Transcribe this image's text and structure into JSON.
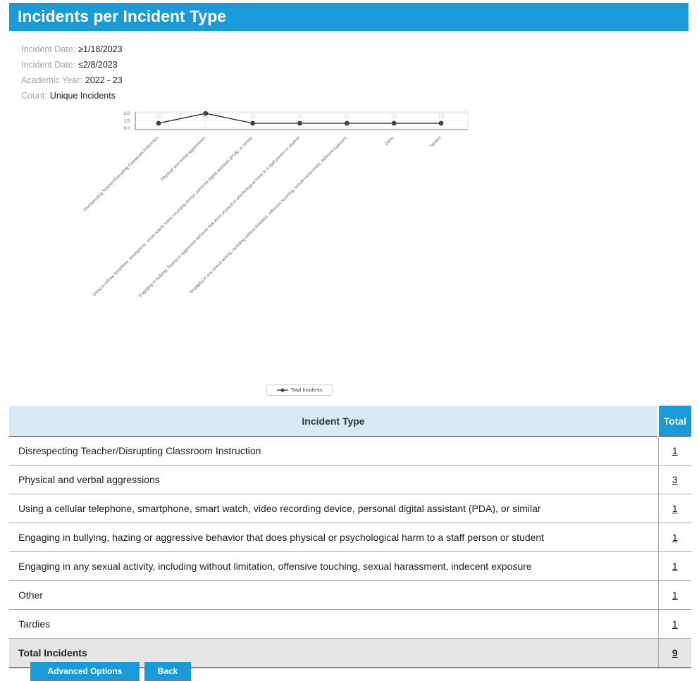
{
  "header": {
    "title": "Incidents per Incident Type"
  },
  "filters": [
    {
      "label": "Incident Date",
      "value": "≥1/18/2023"
    },
    {
      "label": "Incident Date",
      "value": "≤2/8/2023"
    },
    {
      "label": "Academic Year",
      "value": "2022 - 23"
    },
    {
      "label": "Count",
      "value": "Unique Incidents"
    }
  ],
  "chart_data": {
    "type": "line",
    "categories": [
      "Disrespecting Teacher/Disrupting Classroom Instruction",
      "Physical and verbal aggressions",
      "Using a cellular telephone, smartphone, smart watch, video recording device, personal digital assistant (PDA), or similar",
      "Engaging in bullying, hazing or aggressive behavior that does physical or psychological harm to a staff person or student",
      "Engaging in any sexual activity, including without limitation, offensive touching, sexual harassment, indecent exposure",
      "Other",
      "Tardies"
    ],
    "series": [
      {
        "name": "Total Incidents",
        "values": [
          1,
          3,
          1,
          1,
          1,
          1,
          1
        ]
      }
    ],
    "y_ticks": [
      "3.0",
      "1.5",
      "0.0"
    ],
    "ylim": [
      0,
      3
    ],
    "data_labels": [
      "1.0",
      "3.0",
      "1.0",
      "1.0",
      "1.0",
      "1.0",
      "1.0"
    ],
    "colors": {
      "line": "#222222",
      "marker": "#444444",
      "grid": "#dddddd"
    },
    "legend_position": "bottom-center"
  },
  "table": {
    "headers": {
      "type": "Incident Type",
      "total": "Total"
    },
    "rows": [
      {
        "type": "Disrespecting Teacher/Disrupting Classroom Instruction",
        "total": "1"
      },
      {
        "type": "Physical and verbal aggressions",
        "total": "3"
      },
      {
        "type": "Using a cellular telephone, smartphone, smart watch, video recording device, personal digital assistant (PDA), or similar",
        "total": "1"
      },
      {
        "type": "Engaging in bullying, hazing or aggressive behavior that does physical or psychological harm to a staff person or student",
        "total": "1"
      },
      {
        "type": "Engaging in any sexual activity, including without limitation, offensive touching, sexual harassment, indecent exposure",
        "total": "1"
      },
      {
        "type": "Other",
        "total": "1"
      },
      {
        "type": "Tardies",
        "total": "1"
      }
    ],
    "footer": {
      "label": "Total Incidents",
      "total": "9"
    }
  },
  "buttons": {
    "advanced": "Advanced Options",
    "back": "Back"
  },
  "colors": {
    "accent": "#1a9ad8",
    "header_bg": "#d9eaf5",
    "total_row_bg": "#e6e6e6"
  }
}
